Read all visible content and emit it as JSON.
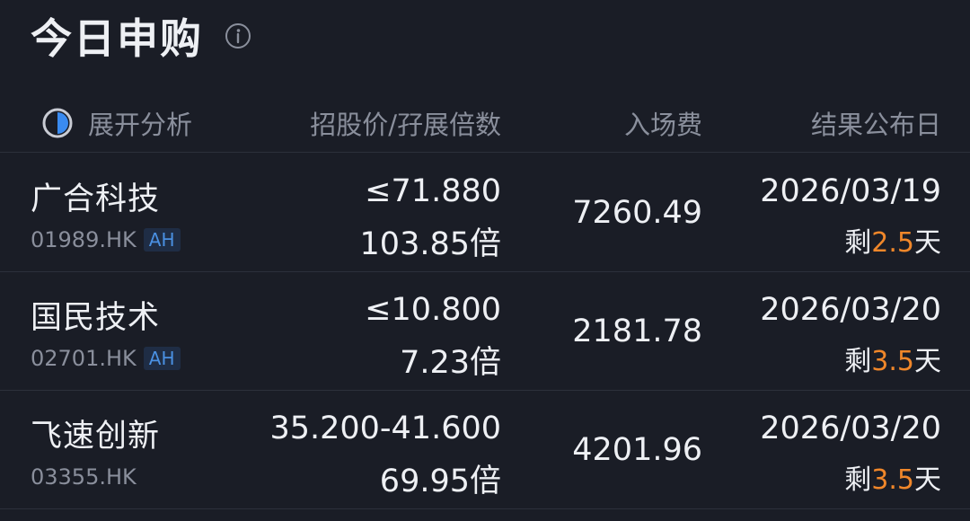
{
  "page_title": "今日申购",
  "icons": {
    "info": "info-icon",
    "expand": "pie-chart-icon"
  },
  "colors": {
    "background": "#1a1d26",
    "accent_orange": "#f0872a",
    "badge_blue": "#4a90e2"
  },
  "header": {
    "expand_label": "展开分析",
    "price_label": "招股价/孖展倍数",
    "fee_label": "入场费",
    "date_label": "结果公布日"
  },
  "rows": [
    {
      "name": "广合科技",
      "code": "01989.HK",
      "badge": "AH",
      "price": "≤71.880",
      "multiple": "103.85倍",
      "fee": "7260.49",
      "date": "2026/03/19",
      "remain_prefix": "剩",
      "remain_days": "2.5",
      "remain_suffix": "天"
    },
    {
      "name": "国民技术",
      "code": "02701.HK",
      "badge": "AH",
      "price": "≤10.800",
      "multiple": "7.23倍",
      "fee": "2181.78",
      "date": "2026/03/20",
      "remain_prefix": "剩",
      "remain_days": "3.5",
      "remain_suffix": "天"
    },
    {
      "name": "飞速创新",
      "code": "03355.HK",
      "badge": "",
      "price": "35.200-41.600",
      "multiple": "69.95倍",
      "fee": "4201.96",
      "date": "2026/03/20",
      "remain_prefix": "剩",
      "remain_days": "3.5",
      "remain_suffix": "天"
    }
  ]
}
